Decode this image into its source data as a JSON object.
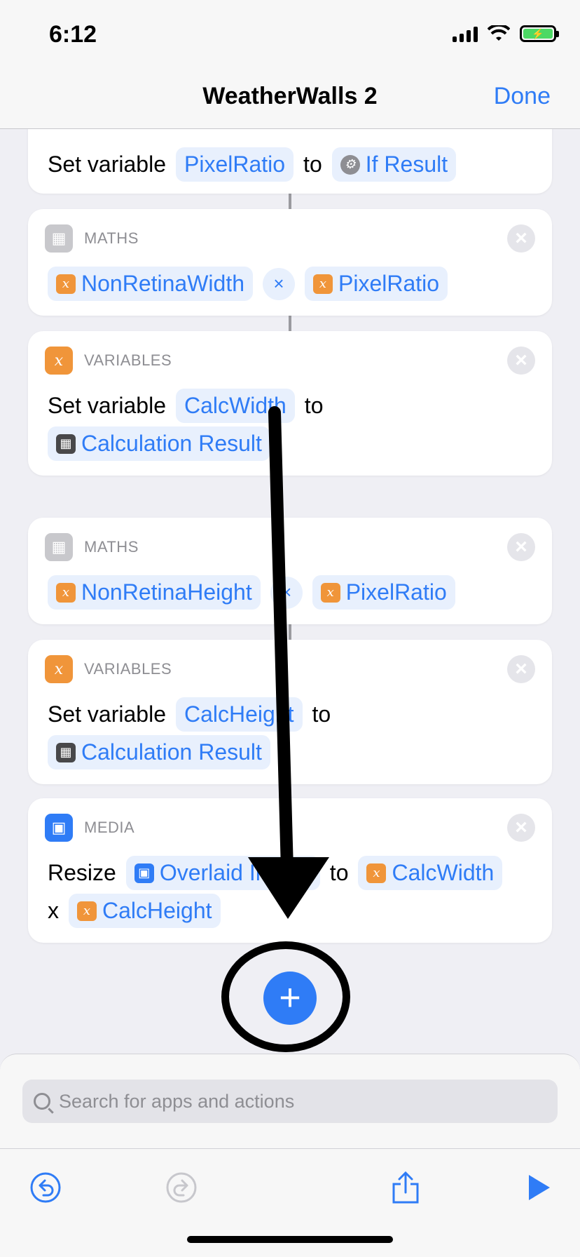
{
  "status": {
    "time": "6:12"
  },
  "nav": {
    "title": "WeatherWalls 2",
    "done": "Done"
  },
  "actions": [
    {
      "category": "",
      "verb": "Set variable",
      "var": "PixelRatio",
      "to": "to",
      "value": "If Result"
    },
    {
      "category": "MATHS",
      "left": "NonRetinaWidth",
      "op": "×",
      "right": "PixelRatio"
    },
    {
      "category": "VARIABLES",
      "verb": "Set variable",
      "var": "CalcWidth",
      "to": "to",
      "value": "Calculation Result"
    },
    {
      "category": "MATHS",
      "left": "NonRetinaHeight",
      "op": "×",
      "right": "PixelRatio"
    },
    {
      "category": "VARIABLES",
      "verb": "Set variable",
      "var": "CalcHeight",
      "to": "to",
      "value": "Calculation Result"
    },
    {
      "category": "MEDIA",
      "verb": "Resize",
      "image": "Overlaid Image",
      "to": "to",
      "width": "CalcWidth",
      "x": "x",
      "height": "CalcHeight"
    }
  ],
  "add_button": "+",
  "search": {
    "placeholder": "Search for apps and actions"
  },
  "icons": [
    "undo-icon",
    "redo-icon",
    "share-icon",
    "play-icon"
  ],
  "colors": {
    "accent": "#2f7cf6",
    "variable": "#f0953a"
  }
}
